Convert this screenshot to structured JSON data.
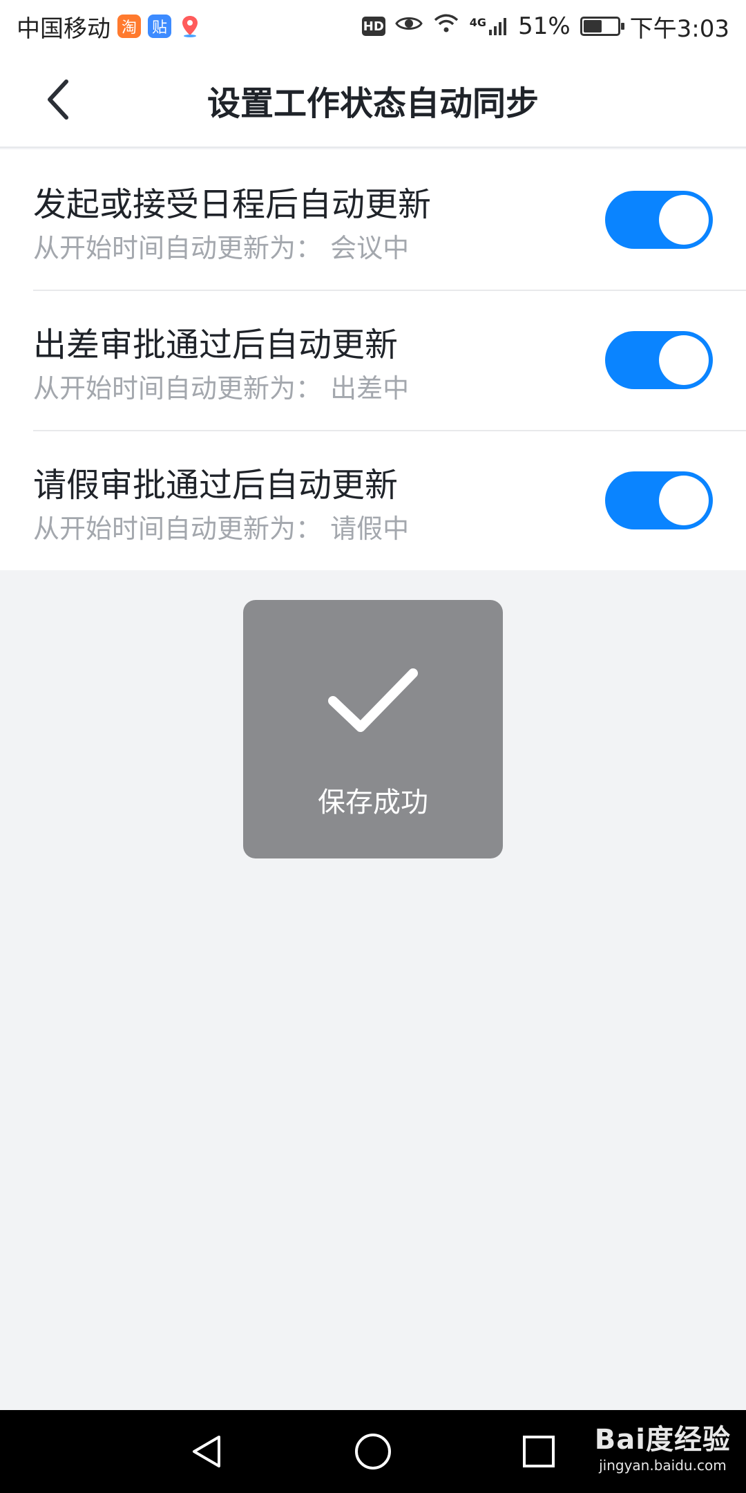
{
  "status_bar": {
    "carrier": "中国移动",
    "app_badges": [
      {
        "icon": "taobao-icon",
        "glyph": "淘"
      },
      {
        "icon": "tieba-icon",
        "glyph": "贴"
      },
      {
        "icon": "map-pin-icon",
        "glyph": ""
      }
    ],
    "hd": "HD",
    "network": "4G",
    "battery_percent": "51%",
    "battery_level": 0.51,
    "time": "下午3:03"
  },
  "header": {
    "title": "设置工作状态自动同步"
  },
  "settings": {
    "items": [
      {
        "title": "发起或接受日程后自动更新",
        "subtitle": "从开始时间自动更新为： 会议中",
        "enabled": true
      },
      {
        "title": "出差审批通过后自动更新",
        "subtitle": "从开始时间自动更新为： 出差中",
        "enabled": true
      },
      {
        "title": "请假审批通过后自动更新",
        "subtitle": "从开始时间自动更新为： 请假中",
        "enabled": true
      }
    ]
  },
  "toast": {
    "icon": "checkmark-icon",
    "message": "保存成功"
  },
  "nav_bar": {
    "back": "back-triangle-icon",
    "home": "home-circle-icon",
    "recents": "recents-square-icon"
  },
  "watermark": {
    "logo": "Bai度经验",
    "url": "jingyan.baidu.com"
  },
  "colors": {
    "accent": "#0a84ff",
    "toast_bg": "#8a8b8e",
    "page_bg": "#f2f3f5"
  }
}
